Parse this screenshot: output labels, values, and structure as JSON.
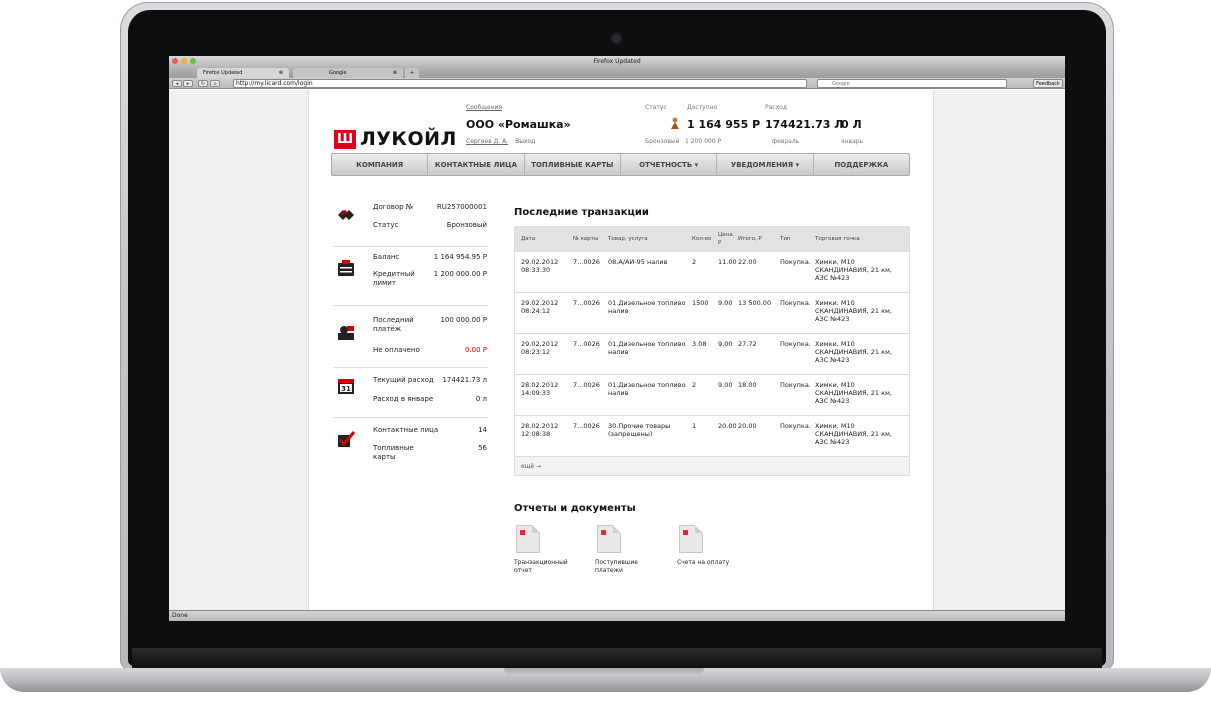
{
  "browser": {
    "window_title": "Firefox Updated",
    "tabs": [
      {
        "label": "Firefox Updated"
      },
      {
        "label": "Google"
      }
    ],
    "url": "http://my.licard.com/login",
    "search_placeholder": "Google",
    "feedback_label": "Feedback",
    "status_text": "Done"
  },
  "header": {
    "logo_mark": "Ш",
    "logo_text": "ЛУКОЙЛ",
    "messages_link": "Сообщения",
    "company": "ООО «Ромашка»",
    "user_link": "Сергеев Д. А.",
    "logout_link": "Выход",
    "status_label": "Статус",
    "status_value": "Бронзовый",
    "status_limit": "1 200 000 Р",
    "available_label": "Доступно",
    "available_value": "1 164 955 Р",
    "expense_label": "Расход",
    "expense_feb_value": "174421.73 Л",
    "expense_feb_month": "февраль",
    "expense_jan_value": "0 Л",
    "expense_jan_month": "январь"
  },
  "menu": [
    {
      "label": "КОМПАНИЯ"
    },
    {
      "label": "КОНТАКТНЫЕ ЛИЦА"
    },
    {
      "label": "ТОПЛИВНЫЕ КАРТЫ"
    },
    {
      "label": "ОТЧЕТНОСТЬ ▾"
    },
    {
      "label": "УВЕДОМЛЕНИЯ ▾"
    },
    {
      "label": "ПОДДЕРЖКА"
    }
  ],
  "left_panel": {
    "contract_label": "Договор №",
    "contract_value": "RU257000001",
    "status_label": "Статус",
    "status_value": "Бронзовый",
    "balance_label": "Баланс",
    "balance_value": "1 164 954.95 Р",
    "credit_label": "Кредитный лимит",
    "credit_value": "1 200 000.00 Р",
    "last_payment_label": "Последний платёж",
    "last_payment_value": "100 000.00 Р",
    "unpaid_label": "Не оплачено",
    "unpaid_value": "0.00 Р",
    "current_expense_label": "Текущий расход",
    "current_expense_value": "174421.73 л",
    "jan_expense_label": "Расход в январе",
    "jan_expense_value": "0 л",
    "calendar_day": "31",
    "contacts_label": "Контактные лица",
    "contacts_value": "14",
    "cards_label": "Топливные карты",
    "cards_value": "56"
  },
  "transactions": {
    "title": "Последние транзакции",
    "columns": [
      "Дата",
      "№ карты",
      "Товар, услуга",
      "Кол-во",
      "Цена, Р",
      "Итого, Р",
      "Тип",
      "Торговая точка"
    ],
    "rows": [
      {
        "date": "29.02.2012 08:33:30",
        "card": "7...0026",
        "product": "08.А/АИ-95 налив",
        "qty": "2",
        "price": "11.00",
        "total": "22.00",
        "type": "Покупка.",
        "station": "Химки, М10 СКАНДИНАВИЯ, 21 км, АЗС №423"
      },
      {
        "date": "29.02.2012 08:24:12",
        "card": "7...0026",
        "product": "01.Дизельное топливо налив",
        "qty": "1500",
        "price": "9.00",
        "total": "13 500.00",
        "type": "Покупка.",
        "station": "Химки, М10 СКАНДИНАВИЯ, 21 км, АЗС №423"
      },
      {
        "date": "29.02.2012 08:23:12",
        "card": "7...0026",
        "product": "01.Дизельное топливо налив",
        "qty": "3.08",
        "price": "9.00",
        "total": "27.72",
        "type": "Покупка.",
        "station": "Химки, М10 СКАНДИНАВИЯ, 21 км, АЗС №423"
      },
      {
        "date": "28.02.2012 14:09:33",
        "card": "7...0026",
        "product": "01.Дизельное топливо налив",
        "qty": "2",
        "price": "9.00",
        "total": "18.00",
        "type": "Покупка.",
        "station": "Химки, М10 СКАНДИНАВИЯ, 21 км, АЗС №423"
      },
      {
        "date": "28.02.2012 12:08:38",
        "card": "7...0026",
        "product": "30.Прочие товары (запрещены)",
        "qty": "1",
        "price": "20.00",
        "total": "20.00",
        "type": "Покупка.",
        "station": "Химки, М10 СКАНДИНАВИЯ, 21 км, АЗС №423"
      }
    ],
    "more_link": "ещё →"
  },
  "reports": {
    "title": "Отчеты и документы",
    "items": [
      {
        "label": "Транзакционный отчет"
      },
      {
        "label": "Поступившие платежи"
      },
      {
        "label": "Счета на оплату"
      }
    ]
  }
}
